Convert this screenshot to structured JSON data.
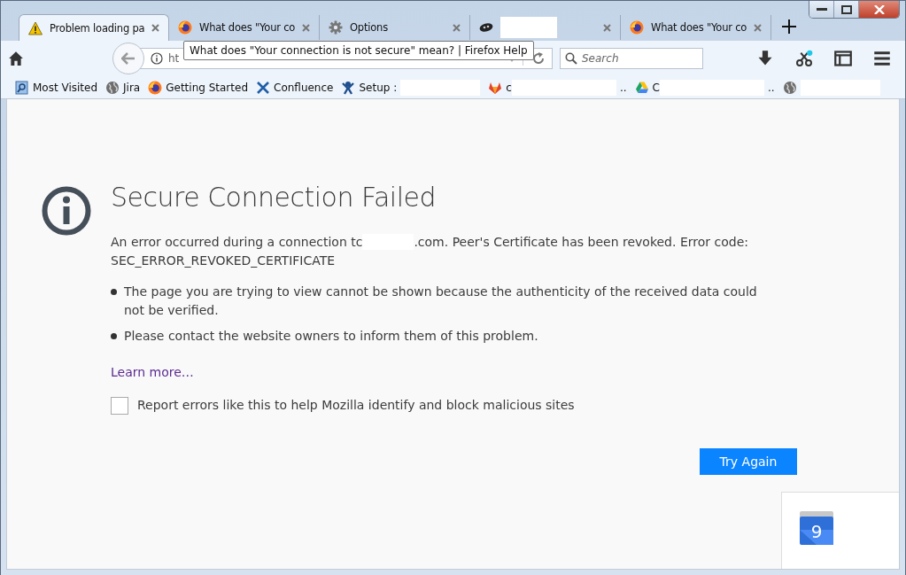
{
  "tabs": [
    {
      "kind": "warning",
      "title": "Problem loading pa",
      "selected": true
    },
    {
      "kind": "browser",
      "title": "What does \"Your co",
      "selected": false
    },
    {
      "kind": "settings",
      "title": "Options",
      "selected": false
    },
    {
      "kind": "badge",
      "redacted": true,
      "selected": false
    },
    {
      "kind": "browser",
      "title": "What does \"Your co",
      "selected": false
    }
  ],
  "url_bar": {
    "value": "ht"
  },
  "tooltip": "What does \"Your connection is not secure\" mean? | Firefox Help",
  "search": {
    "placeholder": "Search"
  },
  "bookmarks": [
    {
      "kind": "folder",
      "label": "Most Visited"
    },
    {
      "kind": "globe",
      "label": "Jira"
    },
    {
      "kind": "browser",
      "label": "Getting Started"
    },
    {
      "kind": "confluence",
      "label": "Confluence"
    },
    {
      "kind": "person",
      "label": "Setup :",
      "redacted": true
    },
    {
      "kind": "fox",
      "label": "c",
      "redacted": true,
      "tail": ".."
    },
    {
      "kind": "drive",
      "label": "C",
      "redacted": true,
      "tail": ".."
    },
    {
      "kind": "globe",
      "redacted": true
    }
  ],
  "error": {
    "title": "Secure Connection Failed",
    "message_start": "An error occurred during a connection tc",
    "message_end": ".com. Peer's Certificate has been revoked. Error code:",
    "code": "SEC_ERROR_REVOKED_CERTIFICATE",
    "bullets": [
      "The page you are trying to view cannot be shown because the authenticity of the received data could not be verified.",
      "Please contact the website owners to inform them of this problem."
    ],
    "link": "Learn more…",
    "report": {
      "label": "Report errors like this to help Mozilla identify and block malicious sites",
      "checked": false
    },
    "button": "Try Again"
  },
  "notification": {
    "day": "9"
  }
}
